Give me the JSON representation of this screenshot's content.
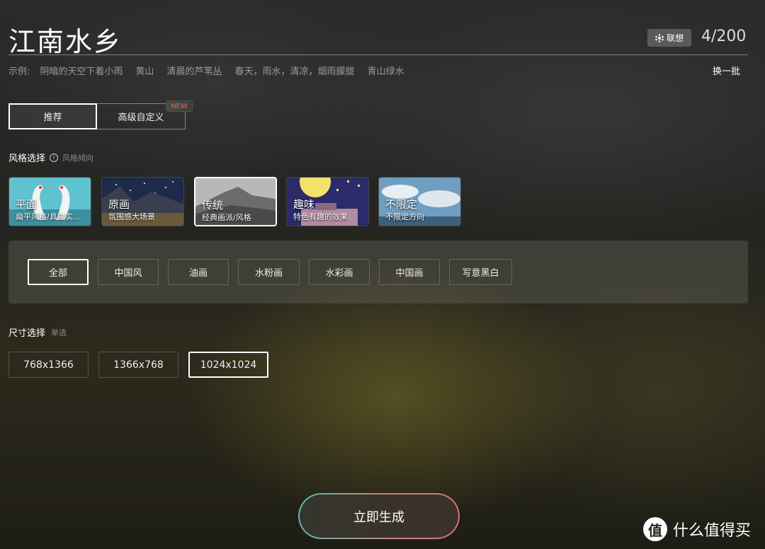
{
  "header": {
    "title": "江南水乡",
    "assoc_label": "联想",
    "counter": "4/200"
  },
  "examples": {
    "label": "示例:",
    "items": [
      "阴暗的天空下着小雨",
      "黄山",
      "清晨的芦苇丛",
      "春天，雨水，清凉，烟雨朦胧",
      "青山绿水"
    ],
    "refresh_label": "换一批"
  },
  "tabs": {
    "items": [
      "推荐",
      "高级自定义"
    ],
    "active": 0,
    "new_badge": "NEW"
  },
  "style_section": {
    "title": "风格选择",
    "info_icon": "info-icon",
    "subtitle": "风格倾向",
    "cards": [
      {
        "name": "平面",
        "desc": "扁平风格/具象实..."
      },
      {
        "name": "原画",
        "desc": "氛围感大场景"
      },
      {
        "name": "传统",
        "desc": "经典画派/风格"
      },
      {
        "name": "趣味",
        "desc": "特色有趣的效果"
      },
      {
        "name": "不限定",
        "desc": "不限定方向"
      }
    ],
    "active_card": 2
  },
  "sub_styles": {
    "items": [
      "全部",
      "中国风",
      "油画",
      "水粉画",
      "水彩画",
      "中国画",
      "写意黑白"
    ],
    "active": 0
  },
  "size_section": {
    "title": "尺寸选择",
    "subtitle": "单选",
    "options": [
      "768x1366",
      "1366x768",
      "1024x1024"
    ],
    "active": 2
  },
  "generate_label": "立即生成",
  "watermark": {
    "icon_glyph": "值",
    "text": "什么值得买"
  },
  "colors": {
    "new_badge_text": "#e56b38",
    "generate_gradient": [
      "#5fb9b0",
      "#d46f78"
    ]
  }
}
